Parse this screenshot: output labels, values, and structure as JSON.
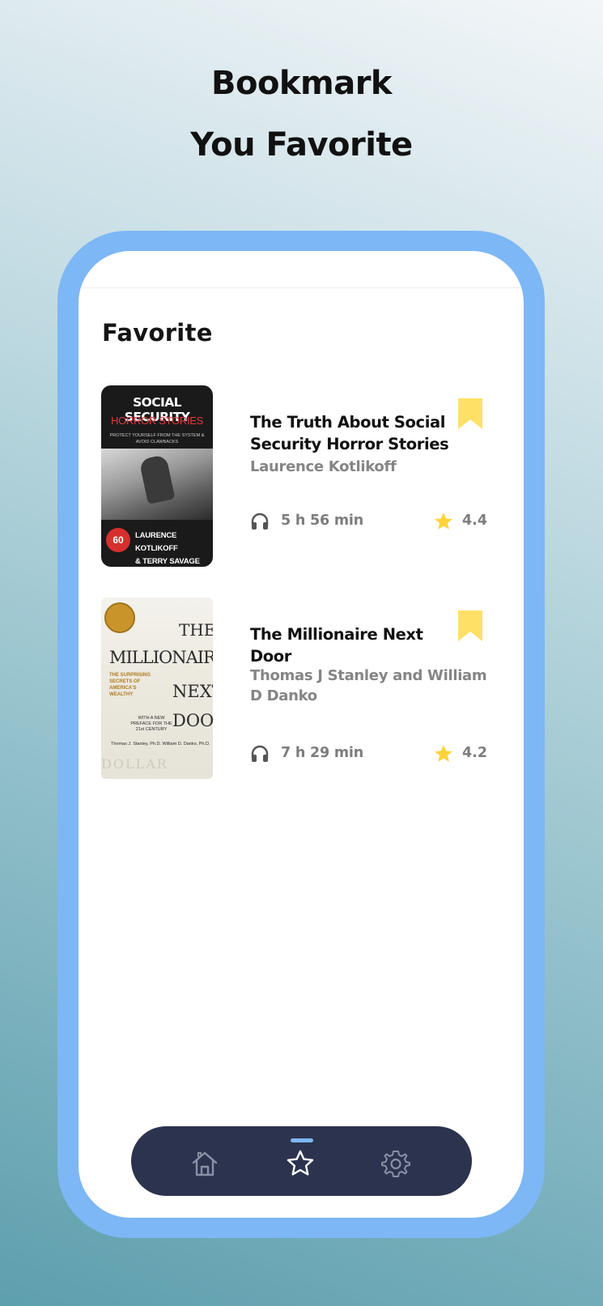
{
  "promo": {
    "line1": "Bookmark",
    "line2": "You Favorite"
  },
  "screen": {
    "title": "Favorite"
  },
  "books": [
    {
      "title": "The Truth About Social Security Horror Stories",
      "author": "Laurence Kotlikoff",
      "duration": "5 h 56 min",
      "rating": "4.4",
      "bookmarked": true,
      "cover": {
        "line1": "SOCIAL SECURITY",
        "line2": "HORROR STORIES",
        "line3": "PROTECT YOURSELF FROM THE SYSTEM & AVOID CLAWBACKS",
        "badge": "60",
        "authors_line1": "LAURENCE KOTLIKOFF",
        "authors_line2": "& TERRY SAVAGE"
      }
    },
    {
      "title": "The Millionaire Next Door",
      "author": "Thomas J Stanley and William D Danko",
      "duration": "7 h 29 min",
      "rating": "4.2",
      "bookmarked": true,
      "cover": {
        "word1": "THE",
        "word2": "MILLIONAIRE",
        "subtitle": "THE SURPRISING SECRETS OF AMERICA'S WEALTHY",
        "word3": "NEXT",
        "preface": "WITH A NEW PREFACE FOR THE 21st CENTURY",
        "word4": "DOOR",
        "authors": "Thomas J. Stanley, Ph.D. William D. Danko, Ph.D.",
        "footer": "DOLLAR"
      }
    }
  ],
  "nav": {
    "items": [
      {
        "name": "home",
        "icon": "home-icon",
        "active": false
      },
      {
        "name": "favorite",
        "icon": "star-outline-icon",
        "active": true
      },
      {
        "name": "settings",
        "icon": "gear-icon",
        "active": false
      }
    ]
  },
  "colors": {
    "frame": "#7db7f5",
    "bookmark": "#ffe066",
    "star": "#ffd43b",
    "nav_bg": "#2c334e",
    "muted_text": "#858585"
  }
}
